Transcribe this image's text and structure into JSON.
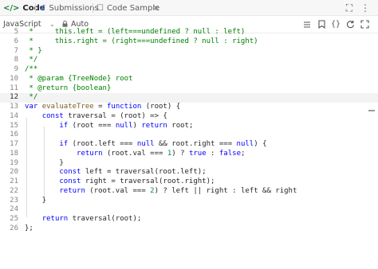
{
  "tabs": [
    {
      "icon": "</>",
      "label": "Code",
      "active": true
    },
    {
      "icon": "↺",
      "label": "Submissions",
      "active": false
    },
    {
      "icon": "☐",
      "label": "Code Sample",
      "active": false
    }
  ],
  "tab_close": "×",
  "window_controls": {
    "expand": "⛶",
    "more": "⋮"
  },
  "toolbar": {
    "language": "JavaScript",
    "mode": "Auto"
  },
  "toolbar_icons": [
    "menu-icon",
    "bookmark-icon",
    "braces-icon",
    "reset-icon",
    "fullscreen-icon"
  ],
  "code_lines": [
    {
      "n": "5",
      "text": " *     this.left = (left===undefined ? null : left)"
    },
    {
      "n": "6",
      "text": " *     this.right = (right===undefined ? null : right)"
    },
    {
      "n": "7",
      "text": " * }"
    },
    {
      "n": "8",
      "text": " */"
    },
    {
      "n": "9",
      "text": "/**"
    },
    {
      "n": "10",
      "text": " * @param {TreeNode} root"
    },
    {
      "n": "11",
      "text": " * @return {boolean}"
    },
    {
      "n": "12",
      "text": " */"
    },
    {
      "n": "13",
      "text": "var evaluateTree = function (root) {"
    },
    {
      "n": "14",
      "text": "    const traversal = (root) => {"
    },
    {
      "n": "15",
      "text": "        if (root === null) return root;"
    },
    {
      "n": "16",
      "text": ""
    },
    {
      "n": "17",
      "text": "        if (root.left === null && root.right === null) {"
    },
    {
      "n": "18",
      "text": "            return (root.val === 1) ? true : false;"
    },
    {
      "n": "19",
      "text": "        }"
    },
    {
      "n": "20",
      "text": "        const left = traversal(root.left);"
    },
    {
      "n": "21",
      "text": "        const right = traversal(root.right);"
    },
    {
      "n": "22",
      "text": "        return (root.val === 2) ? left || right : left && right"
    },
    {
      "n": "23",
      "text": "    }"
    },
    {
      "n": "24",
      "text": ""
    },
    {
      "n": "25",
      "text": "    return traversal(root);"
    },
    {
      "n": "26",
      "text": "};"
    }
  ],
  "current_line": "12",
  "colors": {
    "keyword": "#0000ff",
    "comment": "#008000",
    "number": "#098658",
    "type": "#267f99"
  }
}
